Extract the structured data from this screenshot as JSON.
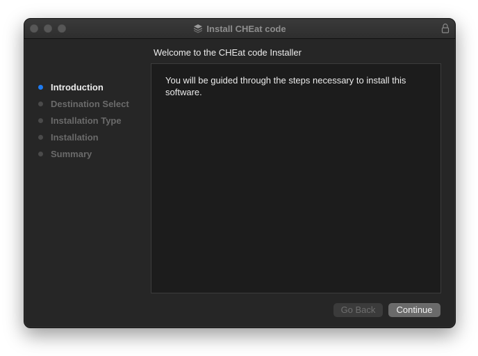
{
  "window": {
    "title": "Install CHEat code"
  },
  "sidebar": {
    "steps": [
      {
        "label": "Introduction",
        "state": "active"
      },
      {
        "label": "Destination Select",
        "state": "inactive"
      },
      {
        "label": "Installation Type",
        "state": "inactive"
      },
      {
        "label": "Installation",
        "state": "inactive"
      },
      {
        "label": "Summary",
        "state": "inactive"
      }
    ]
  },
  "main": {
    "heading": "Welcome to the CHEat code Installer",
    "body": "You will be guided through the steps necessary to install this software."
  },
  "buttons": {
    "back_label": "Go Back",
    "continue_label": "Continue"
  },
  "icons": {
    "title": "package-icon",
    "lock": "lock-icon"
  },
  "colors": {
    "active_step_dot": "#1e7cf2",
    "window_background": "#262626",
    "content_background": "#1c1c1c"
  }
}
